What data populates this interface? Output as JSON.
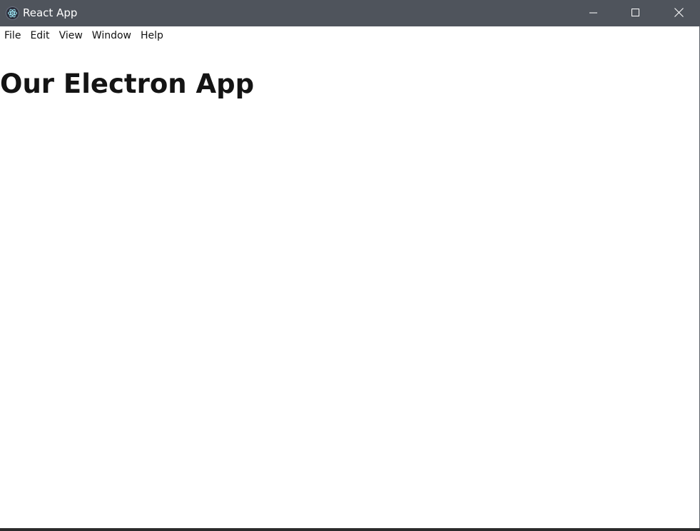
{
  "window": {
    "title": "React App",
    "app_icon": "electron-icon",
    "controls": {
      "minimize_icon": "minimize-icon",
      "maximize_icon": "maximize-icon",
      "close_icon": "close-icon"
    },
    "colors": {
      "titlebar": "#4f545c",
      "titlebar_text": "#ffffff"
    }
  },
  "menubar": {
    "items": [
      {
        "label": "File"
      },
      {
        "label": "Edit"
      },
      {
        "label": "View"
      },
      {
        "label": "Window"
      },
      {
        "label": "Help"
      }
    ]
  },
  "content": {
    "heading": "Our Electron App"
  }
}
